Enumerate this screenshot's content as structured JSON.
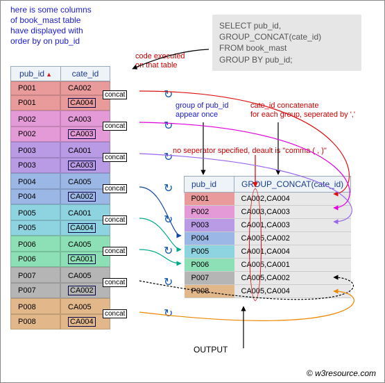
{
  "caption": "here is some columns\nof book_mast table\nhave displayed with\norder by on pub_id",
  "labels": {
    "code_exec": "code executed\non that table",
    "group_once": "group of pub_id\nappear once",
    "cate_concat": "cate_id concatenate\nfor each group, seperated by ','",
    "no_sep": "no seperator specified, deault is \"comma ( , )\"",
    "output": "OUTPUT",
    "copyright": "© w3resource.com",
    "concat": "concat"
  },
  "sql": {
    "l1": "SELECT pub_id,",
    "l2": "GROUP_CONCAT(cate_id)",
    "l3": "FROM book_mast",
    "l4": "GROUP BY pub_id;"
  },
  "source": {
    "headers": {
      "pub": "pub_id",
      "cate": "cate_id"
    },
    "rows": [
      {
        "pub": "P001",
        "cate": "CA002",
        "g": 1
      },
      {
        "pub": "P001",
        "cate": "CA004",
        "g": 1,
        "end": true
      },
      {
        "pub": "P002",
        "cate": "CA003",
        "g": 2
      },
      {
        "pub": "P002",
        "cate": "CA003",
        "g": 2,
        "end": true
      },
      {
        "pub": "P003",
        "cate": "CA001",
        "g": 3
      },
      {
        "pub": "P003",
        "cate": "CA003",
        "g": 3,
        "end": true
      },
      {
        "pub": "P004",
        "cate": "CA005",
        "g": 4
      },
      {
        "pub": "P004",
        "cate": "CA002",
        "g": 4,
        "end": true
      },
      {
        "pub": "P005",
        "cate": "CA001",
        "g": 5
      },
      {
        "pub": "P005",
        "cate": "CA004",
        "g": 5,
        "end": true
      },
      {
        "pub": "P006",
        "cate": "CA005",
        "g": 6
      },
      {
        "pub": "P006",
        "cate": "CA001",
        "g": 6,
        "end": true
      },
      {
        "pub": "P007",
        "cate": "CA005",
        "g": 7
      },
      {
        "pub": "P007",
        "cate": "CA002",
        "g": 7,
        "end": true
      },
      {
        "pub": "P008",
        "cate": "CA005",
        "g": 8
      },
      {
        "pub": "P008",
        "cate": "CA004",
        "g": 8,
        "end": true
      }
    ]
  },
  "result": {
    "headers": {
      "pub": "pub_id",
      "gc": "GROUP_CONCAT(cate_id)"
    },
    "rows": [
      {
        "pub": "P001",
        "gc": "CA002,CA004"
      },
      {
        "pub": "P002",
        "gc": "CA003,CA003"
      },
      {
        "pub": "P003",
        "gc": "CA001,CA003"
      },
      {
        "pub": "P004",
        "gc": "CA005,CA002"
      },
      {
        "pub": "P005",
        "gc": "CA001,CA004"
      },
      {
        "pub": "P006",
        "gc": "CA005,CA001"
      },
      {
        "pub": "P007",
        "gc": "CA005,CA002"
      },
      {
        "pub": "P008",
        "gc": "CA005,CA004"
      }
    ]
  }
}
